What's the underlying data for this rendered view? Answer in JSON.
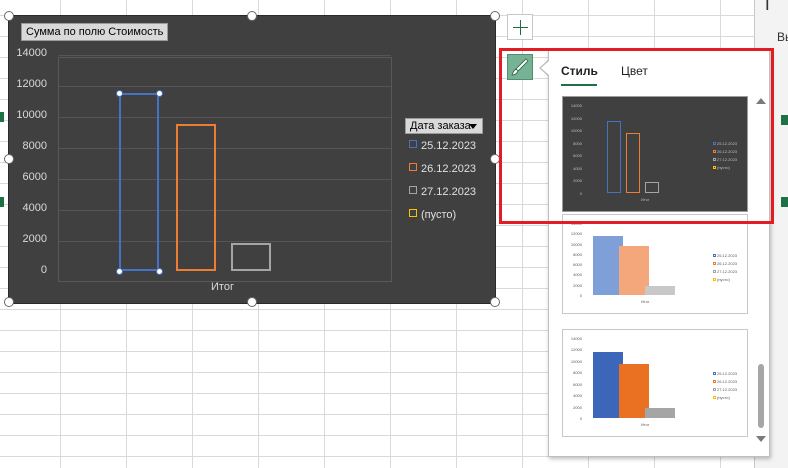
{
  "chart": {
    "title": "Сумма по полю Стоимость",
    "legend_header": "Дата заказа",
    "x_label": "Итог"
  },
  "chart_data": {
    "type": "bar",
    "categories": [
      "Итог"
    ],
    "series": [
      {
        "name": "25.12.2023",
        "values": [
          11500
        ],
        "color": "#4472c4"
      },
      {
        "name": "26.12.2023",
        "values": [
          9500
        ],
        "color": "#ed7d31"
      },
      {
        "name": "27.12.2023",
        "values": [
          1800
        ],
        "color": "#a5a5a5"
      },
      {
        "name": "(пусто)",
        "values": [
          0
        ],
        "color": "#ffc000"
      }
    ],
    "y_ticks": [
      "14000",
      "12000",
      "10000",
      "8000",
      "6000",
      "4000",
      "2000",
      "0"
    ],
    "ylim": [
      0,
      14000
    ]
  },
  "style_panel": {
    "tab_style": "Стиль",
    "tab_color": "Цвет"
  },
  "thumbnail_labels": {
    "y_ticks": [
      "14000",
      "12000",
      "10000",
      "8000",
      "6000",
      "4000",
      "2000",
      "0"
    ],
    "legend": [
      "25.12.2023",
      "26.12.2023",
      "27.12.2023",
      "(пусто)"
    ],
    "x": "Итог"
  },
  "right_strip": {
    "top_glyph": "Г",
    "text": "Вы"
  },
  "colors": {
    "accent": "#1e7145",
    "highlight": "#e31b23",
    "chart_bg": "#404040"
  }
}
